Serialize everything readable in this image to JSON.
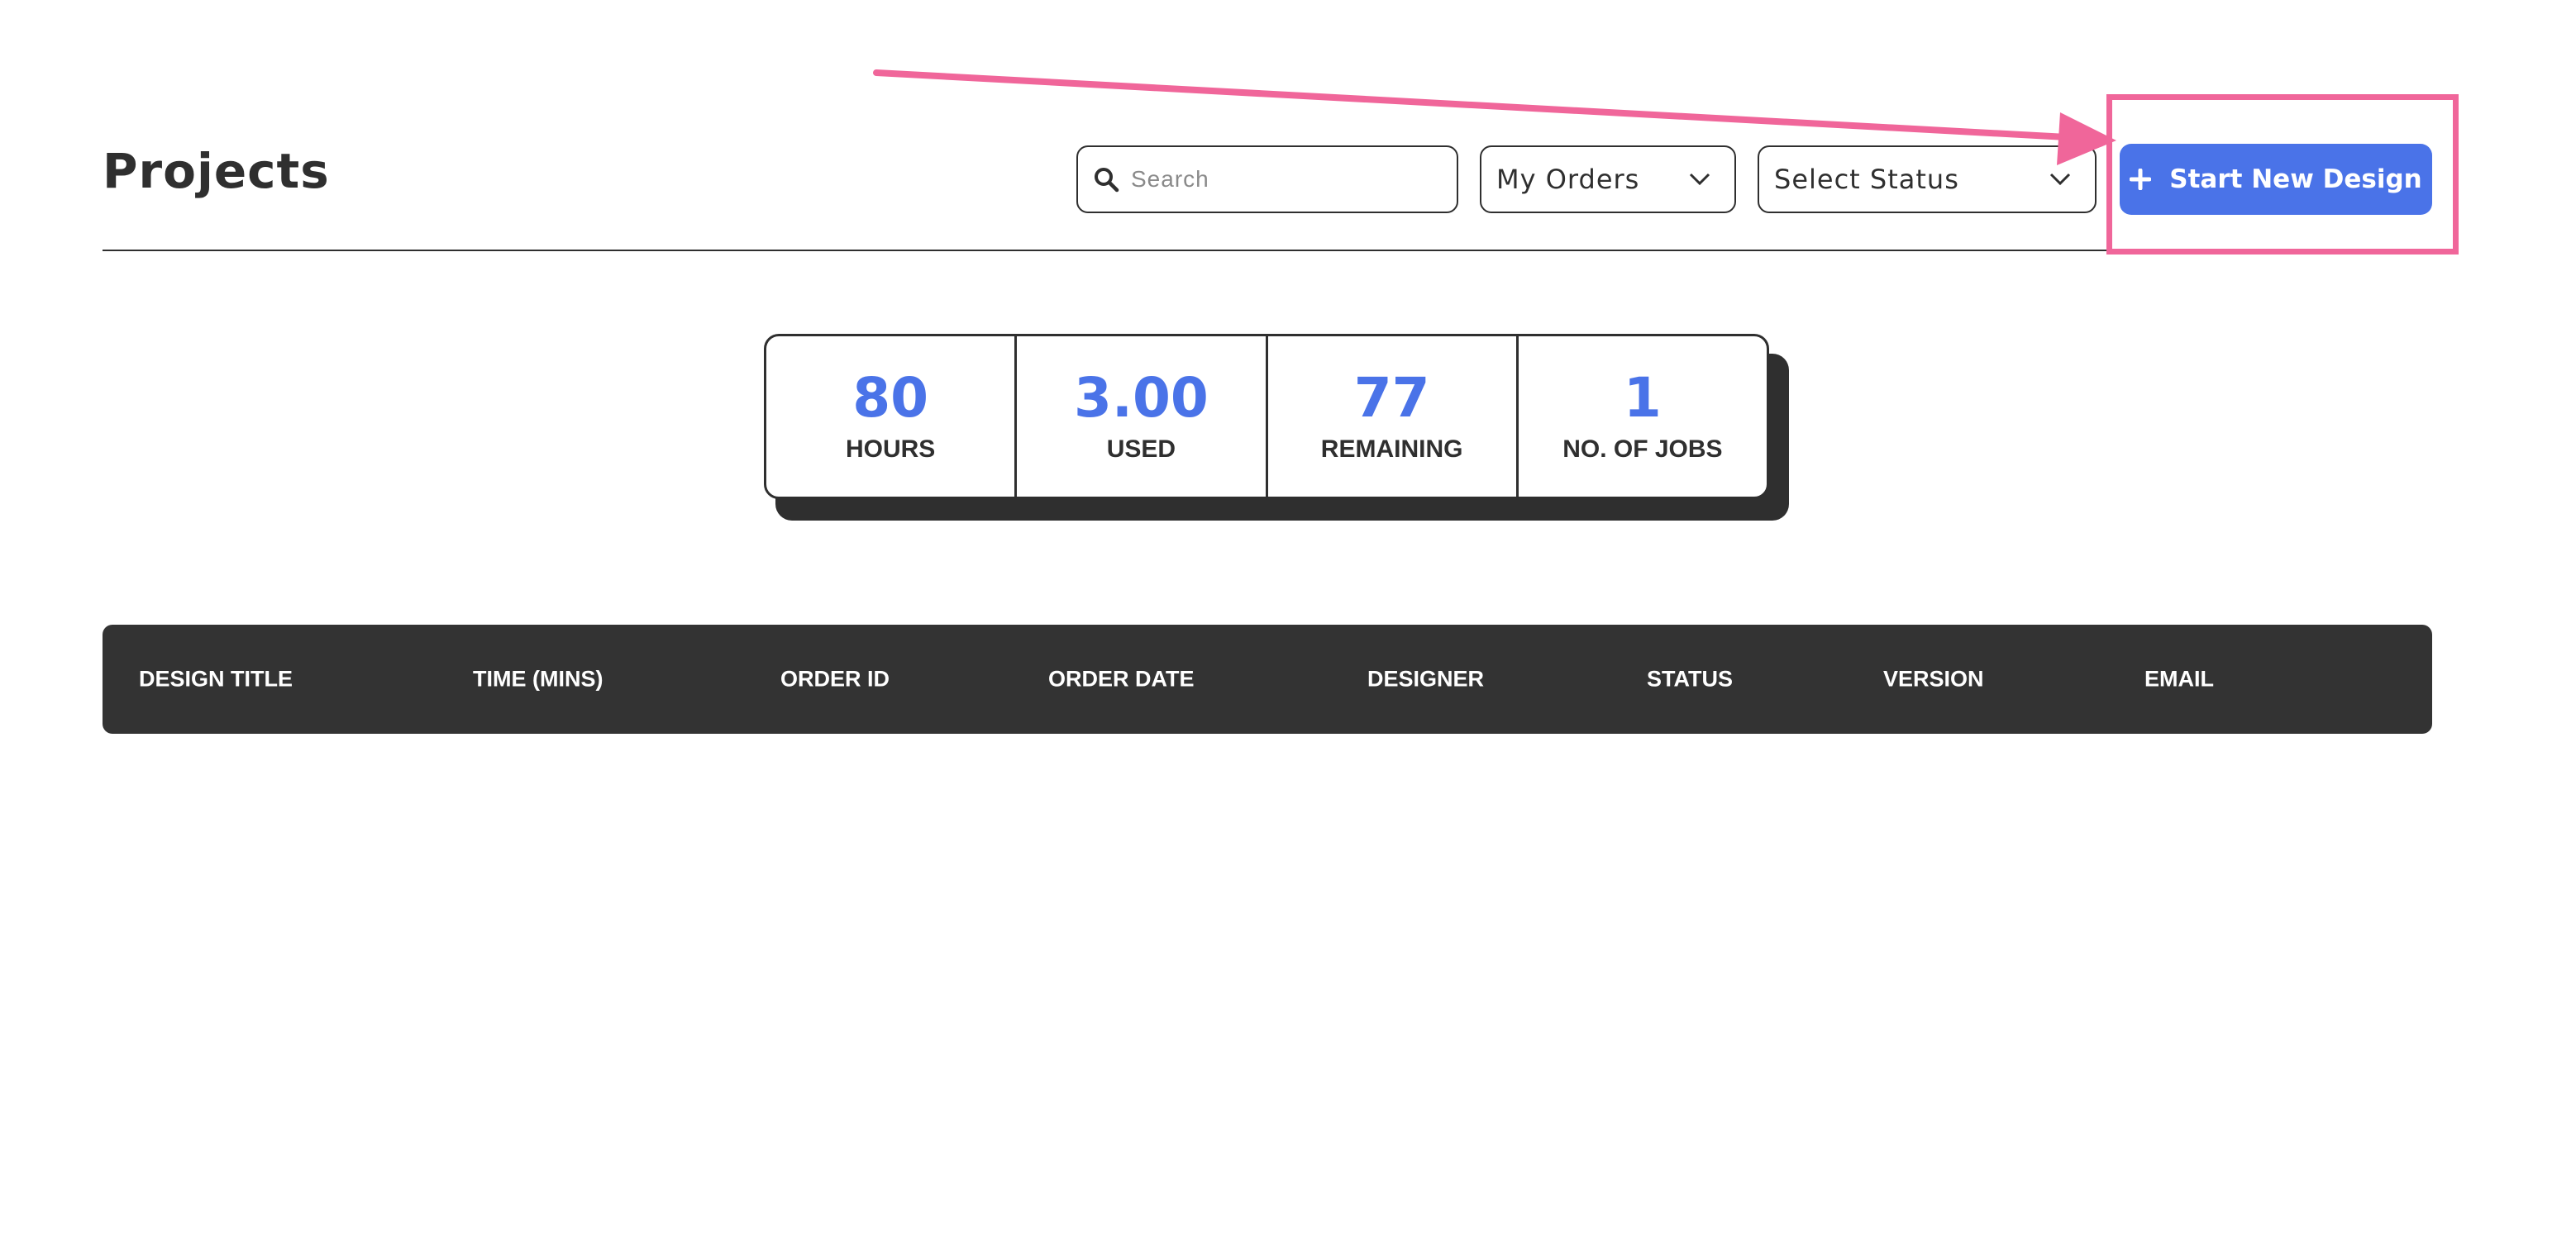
{
  "header": {
    "title": "Projects",
    "search": {
      "placeholder": "Search",
      "value": ""
    },
    "orders_filter": {
      "selected": "My Orders"
    },
    "status_filter": {
      "selected": "Select Status"
    },
    "start_button": {
      "label": "Start New Design"
    }
  },
  "stats": [
    {
      "value": "80",
      "label": "HOURS"
    },
    {
      "value": "3.00",
      "label": "USED"
    },
    {
      "value": "77",
      "label": "REMAINING"
    },
    {
      "value": "1",
      "label": "NO. OF JOBS"
    }
  ],
  "table": {
    "columns": [
      "DESIGN TITLE",
      "TIME (MINS)",
      "ORDER ID",
      "ORDER DATE",
      "DESIGNER",
      "STATUS",
      "VERSION",
      "EMAIL"
    ],
    "rows": []
  },
  "colors": {
    "accent": "#4a73e8",
    "dark": "#2f2f2f",
    "annotation": "#f0669a"
  }
}
